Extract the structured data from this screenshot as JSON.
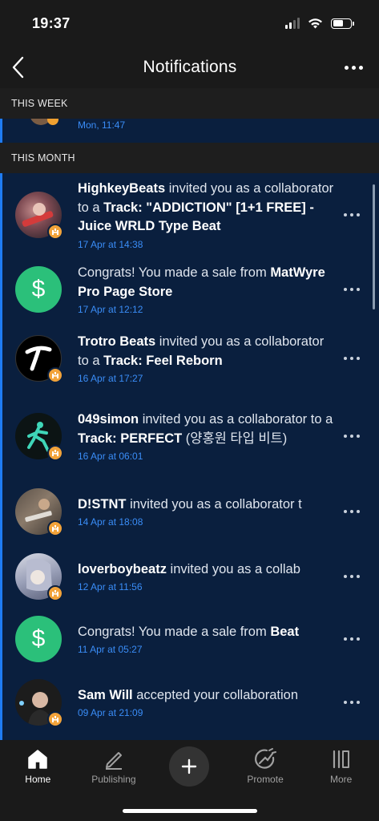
{
  "status": {
    "time": "19:37"
  },
  "header": {
    "title": "Notifications"
  },
  "sections": {
    "week": "THIS WEEK",
    "month": "THIS MONTH"
  },
  "week_items": [
    {
      "time": "Mon, 11:47"
    }
  ],
  "items": [
    {
      "avatar": "photo-guitar",
      "name": "HighkeyBeats",
      "text": " invited you as a collaborator to a ",
      "bold2": "Track: \"ADDICTION\" [1+1 FREE] - Juice WRLD Type Beat",
      "time": "17 Apr at 14:38",
      "badge": "collab-icon"
    },
    {
      "avatar": "dollar-icon",
      "name": "",
      "text": "Congrats! You made a sale from ",
      "bold2": "MatWyre Pro Page Store",
      "time": "17 Apr at 12:12"
    },
    {
      "avatar": "trotro-logo",
      "name": "Trotro Beats",
      "text": " invited you as a collaborator to a ",
      "bold2": "Track: Feel Reborn",
      "time": "16 Apr at 17:27",
      "badge": "collab-icon"
    },
    {
      "avatar": "walking-man",
      "name": "049simon",
      "text": " invited you as a collaborator to a ",
      "bold2": "Track: PERFECT",
      "tail": " (양홍원 타입 비트)",
      "time": "16 Apr at 06:01",
      "badge": "collab-icon"
    },
    {
      "avatar": "photo-guitarist",
      "name": "D!STNT",
      "text": " invited you as a collaborator t",
      "time": "14 Apr at 18:08",
      "badge": "collab-icon"
    },
    {
      "avatar": "photo-anime",
      "name": "loverboybeatz",
      "text": " invited you as a collab",
      "time": "12 Apr at 11:56",
      "badge": "collab-icon"
    },
    {
      "avatar": "dollar-icon",
      "name": "",
      "text": "Congrats! You made a sale from ",
      "bold2": "Beat",
      "time": "11 Apr at 05:27"
    },
    {
      "avatar": "photo-man",
      "name": "Sam Will",
      "text": " accepted your collaboration",
      "time": "09 Apr at 21:09",
      "badge": "collab-icon"
    }
  ],
  "tabs": [
    {
      "label": "Home",
      "icon": "home-icon",
      "active": true
    },
    {
      "label": "Publishing",
      "icon": "pen-icon"
    },
    {
      "label": "",
      "icon": "plus-icon"
    },
    {
      "label": "Promote",
      "icon": "promote-icon"
    },
    {
      "label": "More",
      "icon": "library-icon"
    }
  ],
  "colors": {
    "accent": "#1f7cf2",
    "listBg": "#0a1f3e",
    "timestamp": "#3a8df7",
    "badge": "#f2a33a",
    "dollar": "#2bc07a"
  }
}
